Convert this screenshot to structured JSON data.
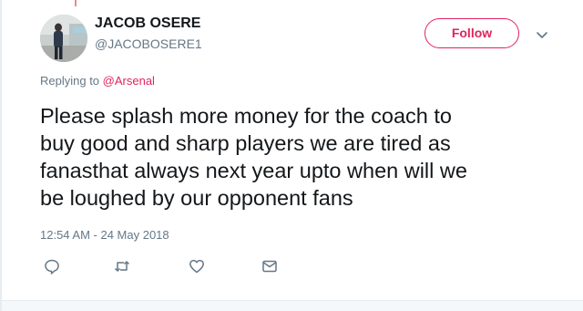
{
  "author": {
    "name": "JACOB OSERE",
    "handle": "@JACOBOSERE1"
  },
  "follow_button": {
    "label": "Follow"
  },
  "menu": {
    "icon": "chevron-down-icon"
  },
  "reply_context": {
    "prefix": "Replying to",
    "mention": "@Arsenal"
  },
  "tweet": {
    "lines": [
      "Please splash more money for the coach to",
      "buy good and sharp players we are tired as",
      "fanasthat always next year upto when will we",
      "be loughed by our opponent fans"
    ],
    "timestamp": "12:54 AM - 24 May 2018"
  },
  "actions": [
    {
      "name": "reply",
      "icon": "reply-icon"
    },
    {
      "name": "retweet",
      "icon": "retweet-icon"
    },
    {
      "name": "like",
      "icon": "heart-icon"
    },
    {
      "name": "direct-message",
      "icon": "envelope-icon"
    }
  ],
  "colors": {
    "follow_accent": "#e0245e",
    "secondary_text": "#657786",
    "primary_text": "#14171a",
    "icon_gray": "#657786"
  }
}
